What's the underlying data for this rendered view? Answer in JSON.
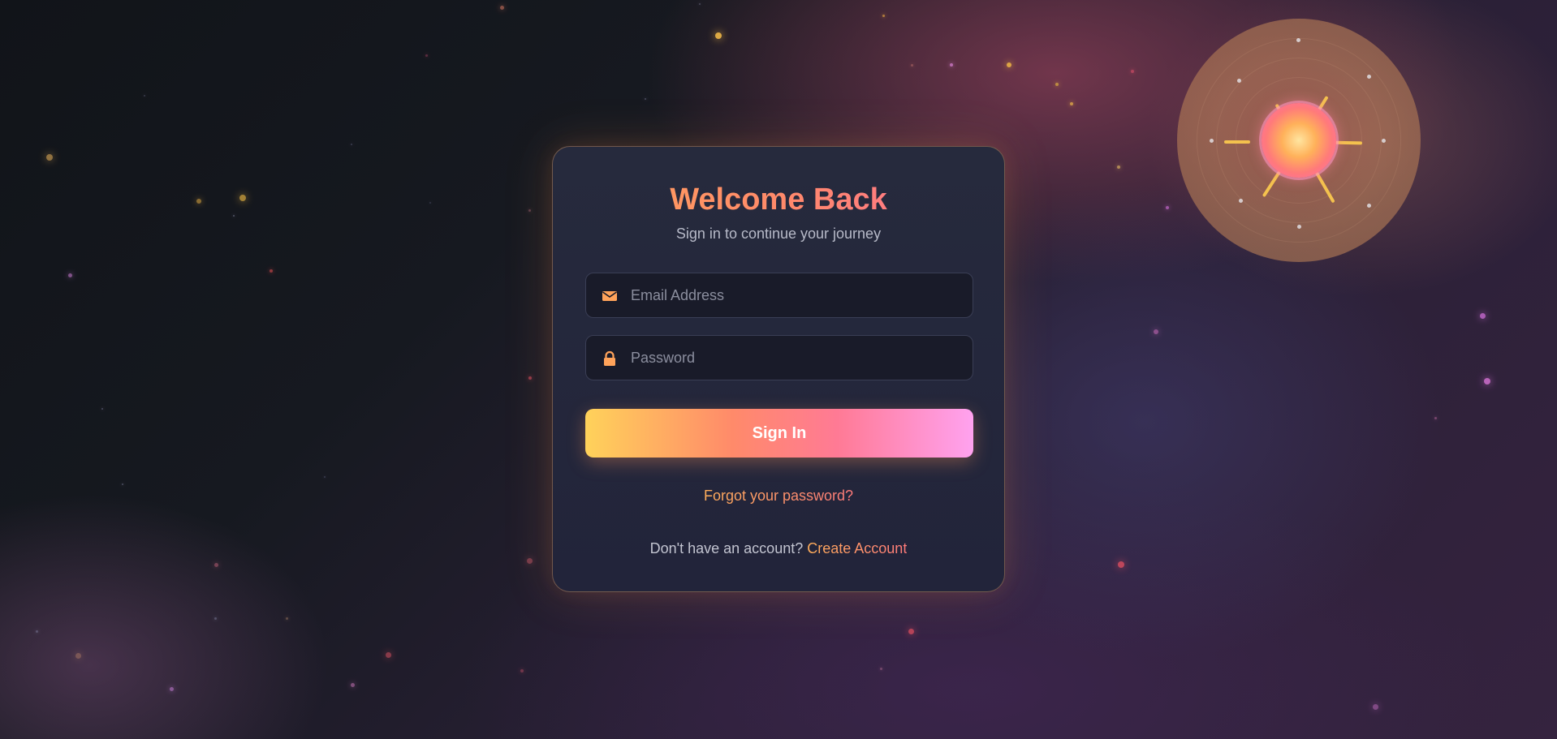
{
  "login": {
    "title": "Welcome Back",
    "subtitle": "Sign in to continue your journey",
    "email": {
      "placeholder": "Email Address",
      "value": "",
      "icon": "envelope-icon"
    },
    "password": {
      "placeholder": "Password",
      "value": "",
      "icon": "lock-icon"
    },
    "signin_label": "Sign In",
    "forgot_label": "Forgot your password?",
    "signup_prompt": "Don't have an account?",
    "signup_link": "Create Account"
  },
  "colors": {
    "accent_orange": "#ffa35a",
    "accent_pink": "#ff6f95",
    "button_start": "#ffd25a",
    "button_end": "#ffa2ef",
    "card_bg": "#262a3d",
    "page_bg": "#111419"
  }
}
